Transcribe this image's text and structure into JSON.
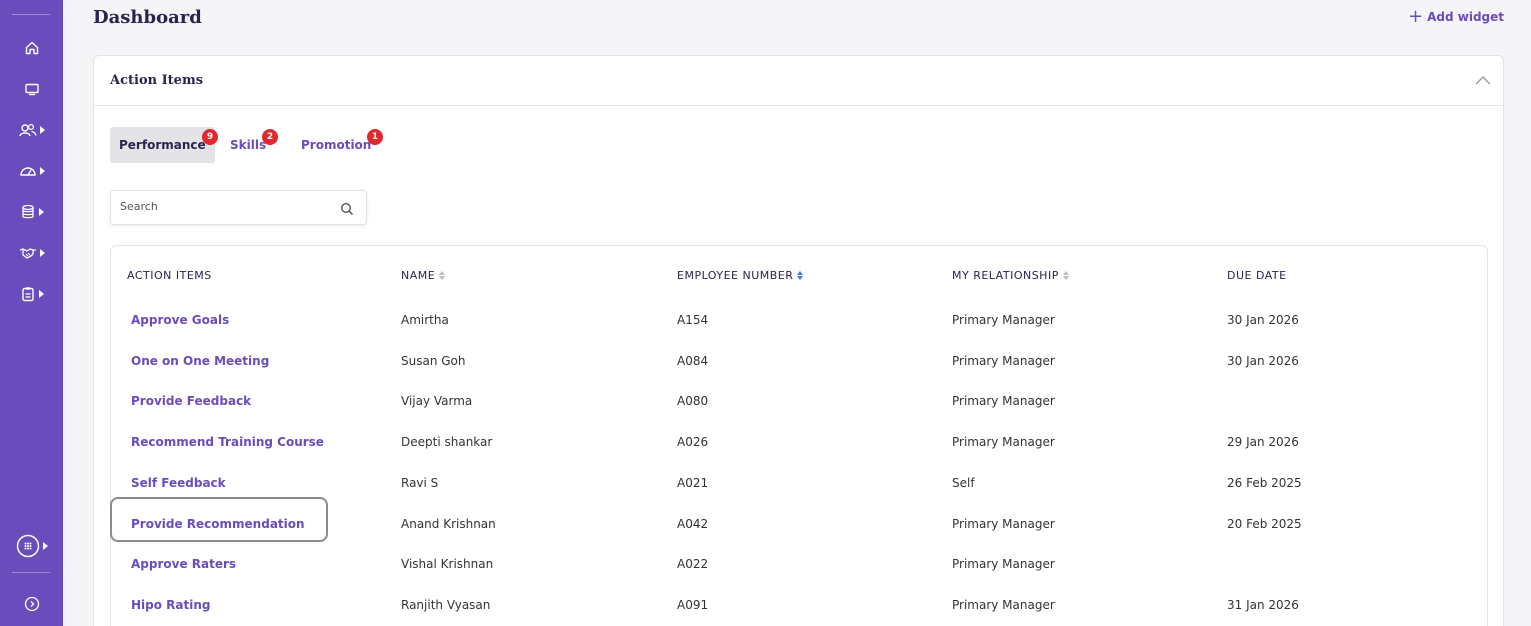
{
  "header": {
    "title": "Dashboard",
    "add_widget_label": "Add widget"
  },
  "card": {
    "title": "Action Items"
  },
  "tabs": [
    {
      "label": "Performance",
      "badge": "9",
      "active": true
    },
    {
      "label": "Skills",
      "badge": "2",
      "active": false
    },
    {
      "label": "Promotion",
      "badge": "1",
      "active": false
    }
  ],
  "search": {
    "placeholder": "Search"
  },
  "table": {
    "columns": [
      "ACTION ITEMS",
      "NAME",
      "EMPLOYEE NUMBER",
      "MY RELATIONSHIP",
      "DUE DATE"
    ],
    "rows": [
      {
        "action": "Approve Goals",
        "name": "Amirtha",
        "emp": "A154",
        "relationship": "Primary Manager",
        "due": "30 Jan 2026"
      },
      {
        "action": "One on One Meeting",
        "name": "Susan Goh",
        "emp": "A084",
        "relationship": "Primary Manager",
        "due": "30 Jan 2026"
      },
      {
        "action": "Provide Feedback",
        "name": "Vijay Varma",
        "emp": "A080",
        "relationship": "Primary Manager",
        "due": ""
      },
      {
        "action": "Recommend Training Course",
        "name": "Deepti shankar",
        "emp": "A026",
        "relationship": "Primary Manager",
        "due": "29 Jan 2026"
      },
      {
        "action": "Self Feedback",
        "name": "Ravi S",
        "emp": "A021",
        "relationship": "Self",
        "due": "26 Feb 2025"
      },
      {
        "action": "Provide Recommendation",
        "name": "Anand Krishnan",
        "emp": "A042",
        "relationship": "Primary Manager",
        "due": "20 Feb 2025"
      },
      {
        "action": "Approve Raters",
        "name": "Vishal Krishnan",
        "emp": "A022",
        "relationship": "Primary Manager",
        "due": ""
      },
      {
        "action": "Hipo Rating",
        "name": "Ranjith Vyasan",
        "emp": "A091",
        "relationship": "Primary Manager",
        "due": "31 Jan 2026"
      }
    ]
  },
  "sidebar": {
    "items": [
      {
        "icon": "home-icon"
      },
      {
        "icon": "monitor-icon"
      },
      {
        "icon": "team-icon"
      },
      {
        "icon": "gauge-icon"
      },
      {
        "icon": "database-icon"
      },
      {
        "icon": "handshake-icon"
      },
      {
        "icon": "clipboard-icon"
      },
      {
        "icon": "apps-grid-icon"
      },
      {
        "icon": "expand-icon"
      }
    ]
  },
  "colors": {
    "brand": "#6a4cbc",
    "badge": "#e0282e",
    "sort_active": "#3d7be0"
  }
}
